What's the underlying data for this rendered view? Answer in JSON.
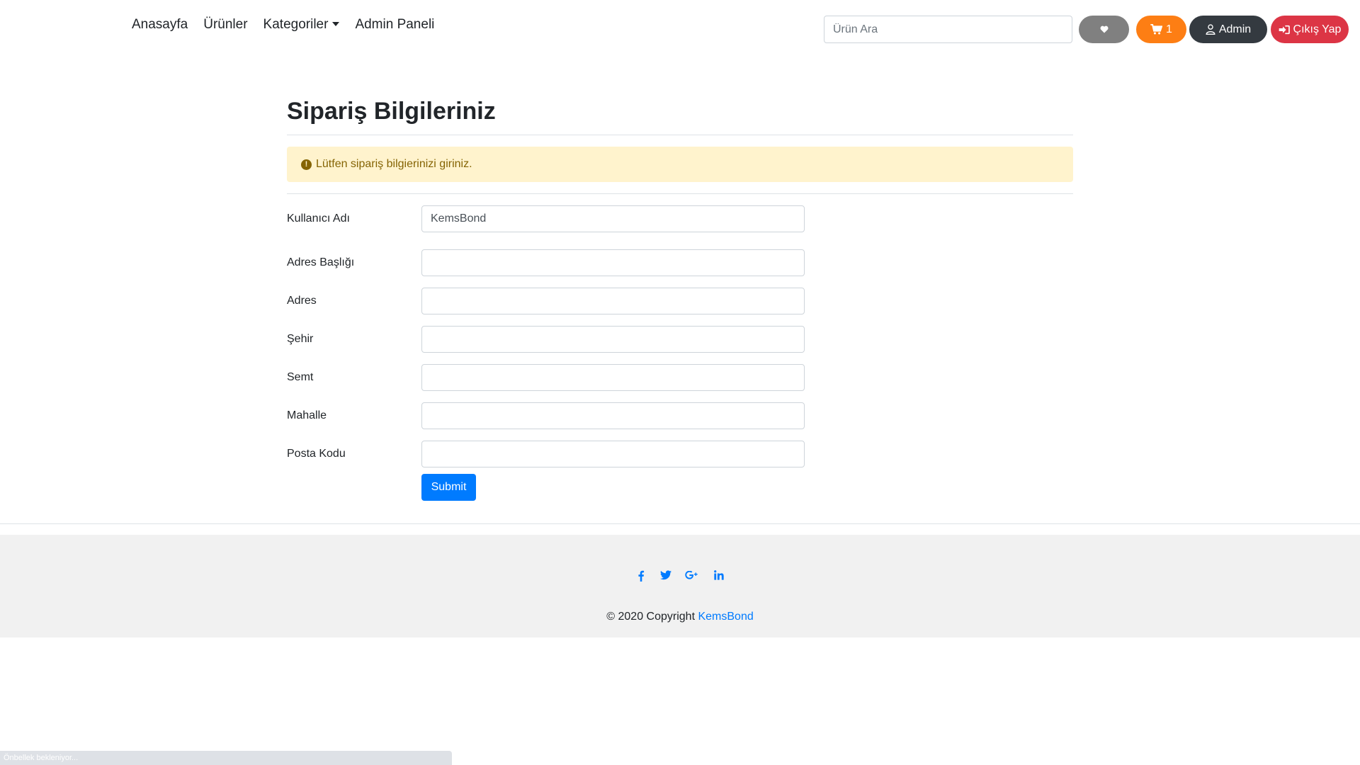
{
  "nav": {
    "links": [
      "Anasayfa",
      "Ürünler",
      "Kategoriler",
      "Admin Paneli"
    ],
    "search_placeholder": "Ürün Ara",
    "cart_count": "1",
    "admin_label": "Admin",
    "logout_label": "Çıkış Yap"
  },
  "main": {
    "title": "Sipariş Bilgileriniz",
    "alert": "Lütfen sipariş bilgierinizi giriniz.",
    "fields": [
      {
        "label": "Kullanıcı Adı",
        "value": "KemsBond"
      },
      {
        "label": "Adres Başlığı",
        "value": ""
      },
      {
        "label": "Adres",
        "value": ""
      },
      {
        "label": "Şehir",
        "value": ""
      },
      {
        "label": "Semt",
        "value": ""
      },
      {
        "label": "Mahalle",
        "value": ""
      },
      {
        "label": "Posta Kodu",
        "value": ""
      }
    ],
    "submit_label": "Submit"
  },
  "footer": {
    "social_icons": [
      "facebook-icon",
      "twitter-icon",
      "google-plus-icon",
      "linkedin-icon"
    ],
    "copyright_prefix": "© 2020 Copyright",
    "copyright_link": "KemsBond"
  },
  "status": "Önbellek bekleniyor...",
  "colors": {
    "primary": "#007bff",
    "warning_bg": "#fff3cd",
    "warning_text": "#856404",
    "cart": "#fd7e14",
    "dark": "#343a40",
    "danger": "#dc3545",
    "fav": "#808080"
  }
}
